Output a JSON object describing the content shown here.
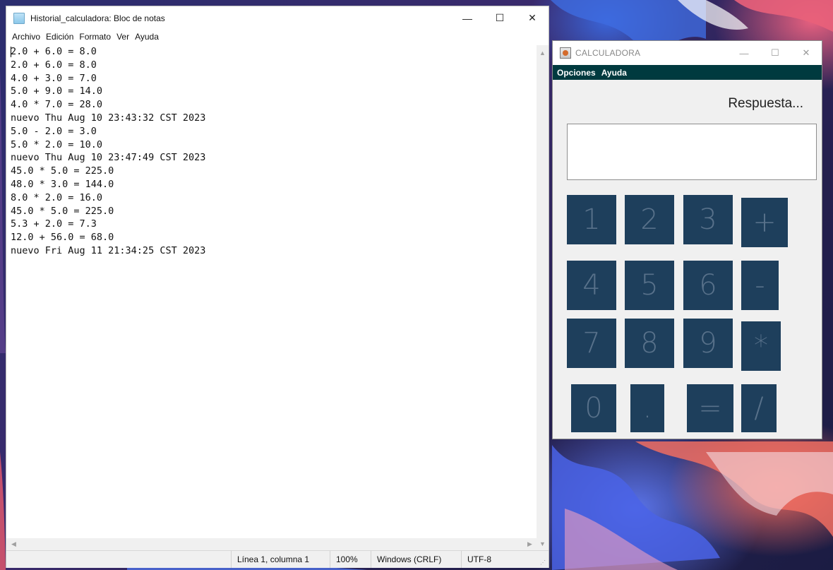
{
  "notepad": {
    "title": "Historial_calculadora: Bloc de notas",
    "window_controls": {
      "minimize": "—",
      "maximize": "☐",
      "close": "✕"
    },
    "menu": [
      "Archivo",
      "Edición",
      "Formato",
      "Ver",
      "Ayuda"
    ],
    "lines": [
      "2.0 + 6.0 = 8.0",
      "2.0 + 6.0 = 8.0",
      "4.0 + 3.0 = 7.0",
      "5.0 + 9.0 = 14.0",
      "4.0 * 7.0 = 28.0",
      "nuevo Thu Aug 10 23:43:32 CST 2023",
      "5.0 - 2.0 = 3.0",
      "5.0 * 2.0 = 10.0",
      "nuevo Thu Aug 10 23:47:49 CST 2023",
      "45.0 * 5.0 = 225.0",
      "48.0 * 3.0 = 144.0",
      "8.0 * 2.0 = 16.0",
      "45.0 * 5.0 = 225.0",
      "5.3 + 2.0 = 7.3",
      "12.0 + 56.0 = 68.0",
      "nuevo Fri Aug 11 21:34:25 CST 2023"
    ],
    "status": {
      "position": "Línea 1, columna 1",
      "zoom": "100%",
      "line_ending": "Windows (CRLF)",
      "encoding": "UTF-8"
    }
  },
  "calculator": {
    "title": "CALCULADORA",
    "window_controls": {
      "minimize": "—",
      "maximize": "☐",
      "close": "✕"
    },
    "menu": [
      "Opciones",
      "Ayuda"
    ],
    "answer_label": "Respuesta...",
    "display_value": "",
    "keys": {
      "k1": "1",
      "k2": "2",
      "k3": "3",
      "plus": "+",
      "k4": "4",
      "k5": "5",
      "k6": "6",
      "minus": "-",
      "k7": "7",
      "k8": "8",
      "k9": "9",
      "times": "*",
      "k0": "0",
      "dot": ".",
      "equals": "=",
      "divide": "/"
    }
  }
}
